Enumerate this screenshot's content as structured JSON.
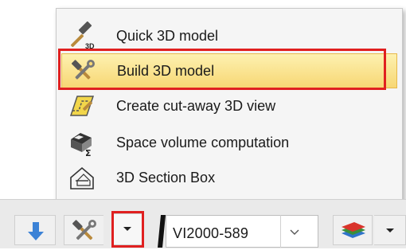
{
  "menu": {
    "items": [
      {
        "label": "Quick 3D model",
        "icon": "hammer-3d-icon"
      },
      {
        "label": "Build 3D model",
        "icon": "hammer-wrench-icon"
      },
      {
        "label": "Create cut-away 3D view",
        "icon": "cutaway-view-icon"
      },
      {
        "label": "Space volume computation",
        "icon": "space-volume-icon"
      },
      {
        "label": "3D Section Box",
        "icon": "section-box-icon"
      }
    ],
    "highlighted_index": 1
  },
  "toolbar": {
    "view_name": "VI2000-589",
    "icons": [
      "down-arrow-icon",
      "hammer-wrench-icon",
      "chevron-down-icon",
      "layers-icon"
    ]
  },
  "colors": {
    "highlight": "#f7d774",
    "callout_red": "#e02020",
    "accent_blue": "#3b82d6"
  }
}
